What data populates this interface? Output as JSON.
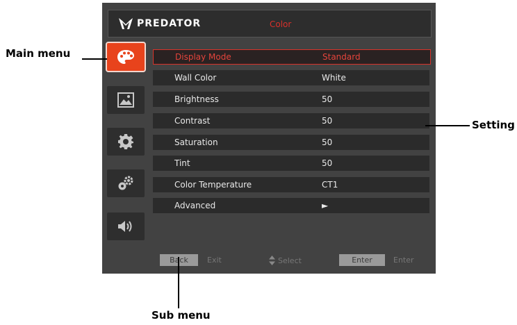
{
  "osd": {
    "brand": "PREDATOR",
    "menu_title": "Color",
    "settings": [
      {
        "label": "Display Mode",
        "value": "Standard",
        "selected": true
      },
      {
        "label": "Wall Color",
        "value": "White"
      },
      {
        "label": "Brightness",
        "value": "50"
      },
      {
        "label": "Contrast",
        "value": "50"
      },
      {
        "label": "Saturation",
        "value": "50"
      },
      {
        "label": "Tint",
        "value": "50"
      },
      {
        "label": "Color Temperature",
        "value": "CT1"
      },
      {
        "label": "Advanced",
        "value": "►"
      }
    ],
    "footer": {
      "back_button": "Back",
      "back_action": "Exit",
      "select_action": "Select",
      "enter_button": "Enter",
      "enter_action": "Enter"
    },
    "sidebar": [
      {
        "icon": "palette-icon",
        "active": true
      },
      {
        "icon": "picture-icon"
      },
      {
        "icon": "gear-icon"
      },
      {
        "icon": "gear-settings-icon"
      },
      {
        "icon": "speaker-icon"
      }
    ],
    "colors": {
      "accent": "#d9302b",
      "active_tile": "#e8431c",
      "panel": "#424242"
    }
  },
  "callouts": {
    "main_menu": "Main menu",
    "setting": "Setting",
    "sub_menu": "Sub menu"
  }
}
